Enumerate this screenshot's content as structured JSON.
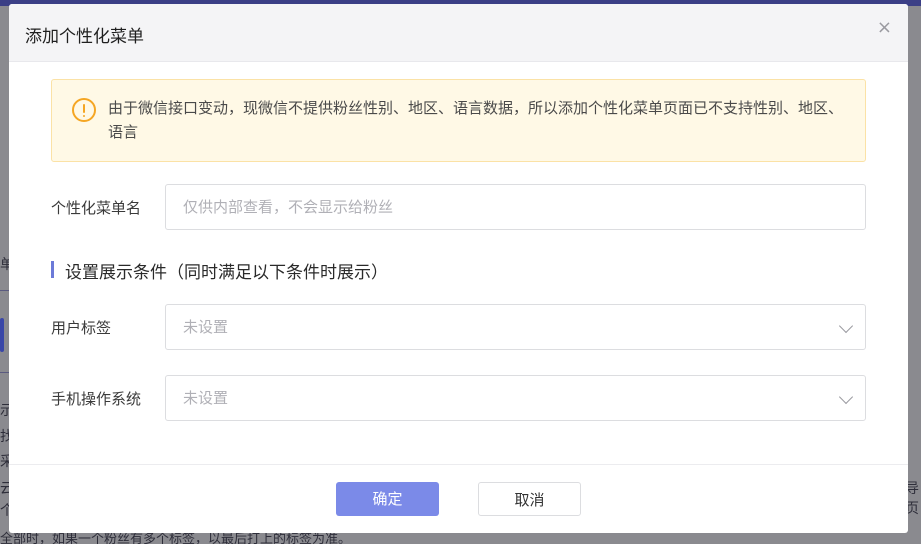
{
  "background": {
    "fragments": [
      "单",
      "示",
      "找",
      "采",
      "云",
      "个",
      "导页",
      "全部时，如果一个粉丝有多个标签，以最后打上的标签为准。"
    ]
  },
  "dialog": {
    "title": "添加个性化菜单",
    "close_symbol": "×"
  },
  "notice": {
    "icon": "warning-circle-icon",
    "text": "由于微信接口变动，现微信不提供粉丝性别、地区、语言数据，所以添加个性化菜单页面已不支持性别、地区、语言"
  },
  "form": {
    "menu_name": {
      "label": "个性化菜单名",
      "value": "",
      "placeholder": "仅供内部查看，不会显示给粉丝"
    },
    "section_title": "设置展示条件（同时满足以下条件时展示）",
    "user_tag": {
      "label": "用户标签",
      "selected": "未设置"
    },
    "mobile_os": {
      "label": "手机操作系统",
      "selected": "未设置"
    }
  },
  "footer": {
    "confirm_label": "确定",
    "cancel_label": "取消"
  },
  "colors": {
    "primary": "#7b8ae8",
    "warning": "#f5a623",
    "notice_bg": "#fff9e6",
    "accent_bar": "#6c7ad8"
  }
}
